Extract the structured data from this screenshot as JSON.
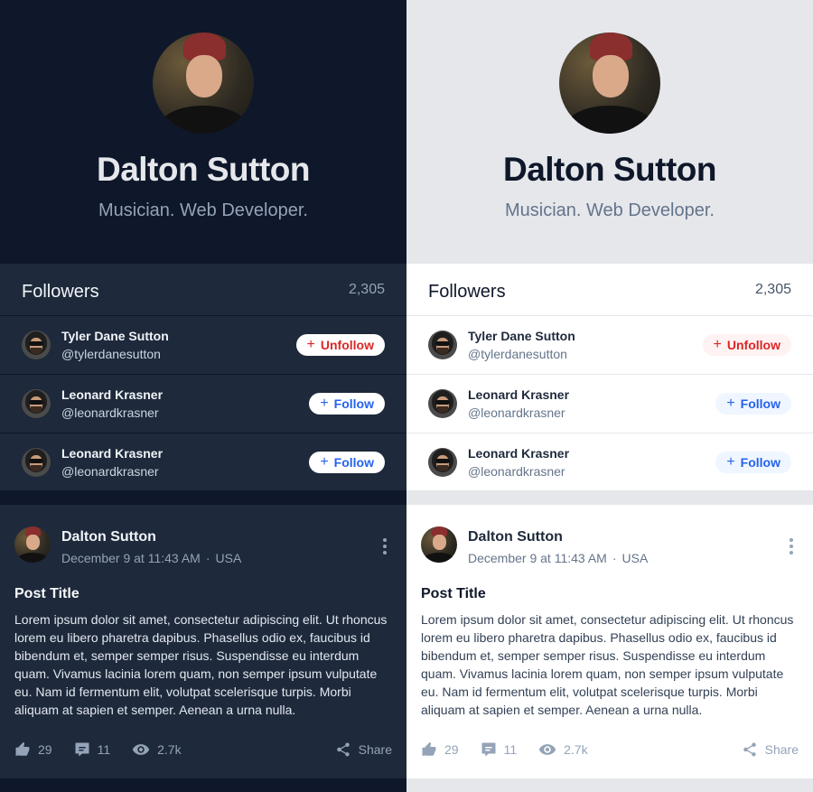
{
  "themes": [
    "dark",
    "light"
  ],
  "profile": {
    "name": "Dalton Sutton",
    "bio": "Musician. Web Developer."
  },
  "followers": {
    "title": "Followers",
    "count": "2,305",
    "items": [
      {
        "name": "Tyler Dane Sutton",
        "handle": "@tylerdanesutton",
        "button": "Unfollow",
        "button_type": "unfollow"
      },
      {
        "name": "Leonard Krasner",
        "handle": "@leonardkrasner",
        "button": "Follow",
        "button_type": "follow"
      },
      {
        "name": "Leonard Krasner",
        "handle": "@leonardkrasner",
        "button": "Follow",
        "button_type": "follow"
      }
    ]
  },
  "post": {
    "author": "Dalton Sutton",
    "date": "December 9 at 11:43 AM",
    "separator": "·",
    "location": "USA",
    "title": "Post Title",
    "body": "Lorem ipsum dolor sit amet, consectetur adipiscing elit. Ut rhoncus lorem eu libero pharetra dapibus. Phasellus odio ex, faucibus id bibendum et, semper semper risus. Suspendisse eu interdum quam. Vivamus lacinia lorem quam, non semper ipsum vulputate eu. Nam id fermentum elit, volutpat scelerisque turpis. Morbi aliquam at sapien et semper. Aenean a urna nulla.",
    "likes": "29",
    "comments": "11",
    "views": "2.7k",
    "share_label": "Share"
  },
  "icons": {
    "plus": "+",
    "like": "thumbs-up-icon",
    "comment": "comment-icon",
    "view": "eye-icon",
    "share": "share-icon",
    "more": "more-vertical-icon"
  },
  "colors": {
    "dark_bg": "#0f172a",
    "dark_card": "#1e293b",
    "light_bg": "#e5e7eb",
    "light_card": "#ffffff",
    "unfollow": "#dc2626",
    "follow": "#2563eb"
  }
}
